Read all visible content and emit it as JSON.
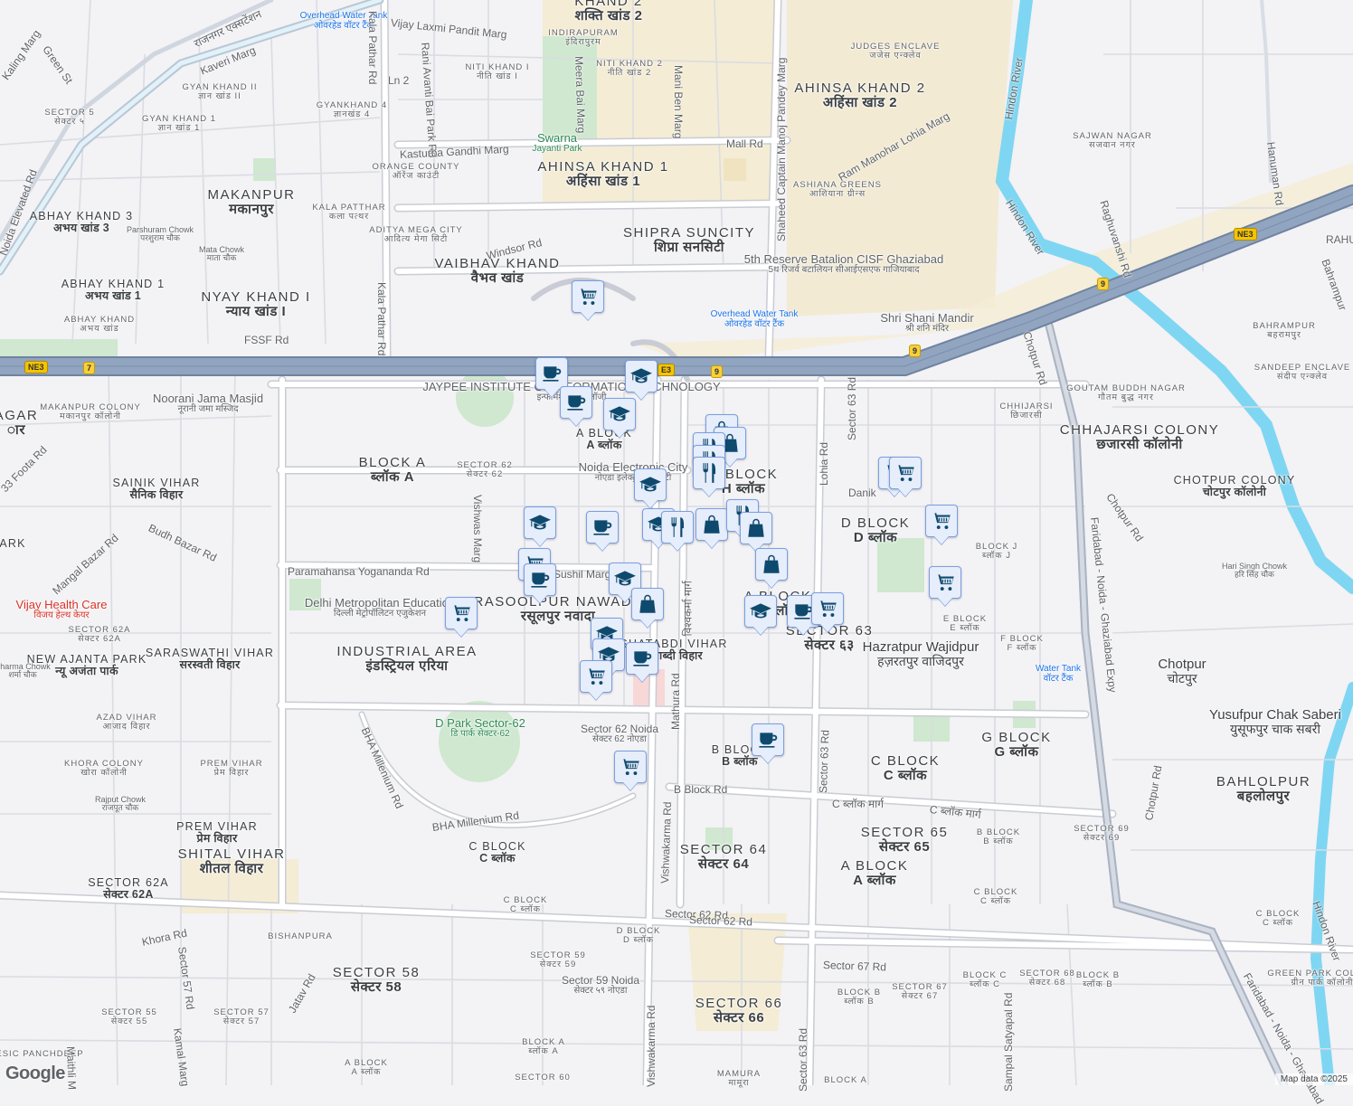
{
  "map": {
    "attribution": "Map data ©2025",
    "logo": "Google",
    "colors": {
      "highway": "#8ea2bd",
      "river": "#7fd6f2",
      "park": "#c8e6c9",
      "beige": "#f4ecd4",
      "marker_bg": "#e6edfb",
      "marker_icon": "#0e4a6e"
    }
  },
  "markers": [
    "shopping-cart",
    "coffee",
    "graduation-cap",
    "coffee",
    "graduation-cap",
    "shopping-bag",
    "shopping-bag",
    "restaurant",
    "restaurant",
    "restaurant",
    "graduation-cap",
    "shopping-cart",
    "shopping-cart",
    "graduation-cap",
    "coffee",
    "graduation-cap",
    "restaurant",
    "shopping-bag",
    "restaurant",
    "shopping-bag",
    "shopping-cart",
    "shopping-cart",
    "coffee",
    "shopping-bag",
    "graduation-cap",
    "shopping-bag",
    "shopping-cart",
    "graduation-cap",
    "coffee",
    "shopping-cart",
    "shopping-cart",
    "graduation-cap",
    "graduation-cap",
    "coffee",
    "shopping-cart",
    "coffee",
    "shopping-cart"
  ],
  "shields": [
    "NE3",
    "7",
    "E3",
    "9",
    "9",
    "9",
    "NE3"
  ],
  "labels": [
    {
      "en": "KHAND 2",
      "hi": "शक्ति खांड 2"
    },
    {
      "en": "INDIRAPURAM",
      "hi": "इंदिरापुरम"
    },
    {
      "en": "NITI KHAND I",
      "hi": "नीति खांड I"
    },
    {
      "en": "NITI KHAND 2",
      "hi": "नीति खांड 2"
    },
    {
      "en": "JUDGES ENCLAVE",
      "hi": "जजेस एन्क्लेव"
    },
    {
      "en": "AHINSA KHAND 2",
      "hi": "अहिंसा खांड 2"
    },
    {
      "en": "SAJWAN NAGAR",
      "hi": "सजवान नगर"
    },
    {
      "en": "GYAN KHAND II",
      "hi": "ज्ञान खांड II"
    },
    {
      "en": "GYANKHAND 4",
      "hi": "ज्ञानखंड 4"
    },
    {
      "en": "SECTOR 5",
      "hi": "सेक्टर ५"
    },
    {
      "en": "GYAN KHAND 1",
      "hi": "ज्ञान खांड 1"
    },
    {
      "en": "Swarna",
      "hi": "Jayanti Park"
    },
    {
      "en": "AHINSA KHAND 1",
      "hi": "अहिंसा खांड 1"
    },
    {
      "en": "ORANGE COUNTY",
      "hi": "ऑरेंज काउंटी"
    },
    {
      "en": "ASHIANA GREENS",
      "hi": "आशियाना ग्रीन्स"
    },
    {
      "en": "MAKANPUR",
      "hi": "मकानपुर"
    },
    {
      "en": "KALA PATTHAR",
      "hi": "कला पत्थर"
    },
    {
      "en": "ABHAY KHAND 3",
      "hi": "अभय खांड 3"
    },
    {
      "en": "SHIPRA SUNCITY",
      "hi": "शिप्रा सनसिटी"
    },
    {
      "en": "Parshuram Chowk",
      "hi": "परशुराम चौक"
    },
    {
      "en": "ADITYA MEGA CITY",
      "hi": "आदित्य मेगा सिटी"
    },
    {
      "en": "Mata Chowk",
      "hi": "माता चौक"
    },
    {
      "en": "VAIBHAV KHAND",
      "hi": "वैभव खांड"
    },
    {
      "en": "ABHAY KHAND 1",
      "hi": "अभय खांड 1"
    },
    {
      "en": "NYAY KHAND I",
      "hi": "न्याय खांड I"
    },
    {
      "en": "ABHAY KHAND",
      "hi": "अभय खांड"
    },
    {
      "en": "5th Reserve Batalion CISF Ghaziabad",
      "hi": "5थ रिजर्व बटालियन सीआईएसएफ गाजियाबाद"
    },
    {
      "en": "Shri Shani Mandir",
      "hi": "श्री शनि मंदिर"
    },
    {
      "en": "Overhead Water Tank",
      "hi": "ओवरहेड वॉटर टैंक"
    },
    {
      "en": "Overhead Water Tank",
      "hi": "ओवरहेड वॉटर टैंक"
    },
    {
      "en": "BAHRAMPUR",
      "hi": "बहरामपुर"
    },
    {
      "en": "SANDEEP ENCLAVE",
      "hi": "संदीप एन्क्लेव"
    },
    {
      "en": "GOUTAM BUDDH NAGAR",
      "hi": "गौतम बुद्ध नगर"
    },
    {
      "en": "CHHIJARSI",
      "hi": "छिजारसी"
    },
    {
      "en": "CHHAJARSI COLONY",
      "hi": "छजारसी कॉलोनी"
    },
    {
      "en": "CHOTPUR COLONY",
      "hi": "चोटपुर कॉलोनी"
    },
    {
      "en": "Noorani Jama Masjid",
      "hi": "नूरानी जमा मस्जिद"
    },
    {
      "en": "MAKANPUR COLONY",
      "hi": "मकानपुर कॉलोनी"
    },
    {
      "en": "AGAR",
      "hi": "ार"
    },
    {
      "en": "BLOCK A",
      "hi": "ब्लॉक A"
    },
    {
      "en": "SECTOR 62",
      "hi": "सेक्टर 62"
    },
    {
      "en": "A BLOCK",
      "hi": "A ब्लॉक"
    },
    {
      "en": "Noida Electronic City",
      "hi": "नोएडा इलेक्ट्रॉनिक सिटी"
    },
    {
      "en": "H BLOCK",
      "hi": "H ब्लॉक"
    },
    {
      "en": "SAINIK VIHAR",
      "hi": "सैनिक विहार"
    },
    {
      "en": "D BLOCK",
      "hi": "D ब्लॉक"
    },
    {
      "en": "BLOCK J",
      "hi": "ब्लॉक J"
    },
    {
      "en": "Hari Singh Chowk",
      "hi": "हरि सिंह चौक"
    },
    {
      "en": "ARK",
      "hi": ""
    },
    {
      "en": "RASOOLPUR NAWADA",
      "hi": "रसूलपुर नवादा"
    },
    {
      "en": "Delhi Metropolitan Education",
      "hi": "दिल्ली मेट्रोपॉलिटन एजुकेशन"
    },
    {
      "en": "Vijay Health Care",
      "hi": "विजय हेल्थ केयर"
    },
    {
      "en": "SECTOR 62A",
      "hi": "सेक्टर 62A"
    },
    {
      "en": "A BLOCK",
      "hi": "A ब्लॉक"
    },
    {
      "en": "SECTOR 63",
      "hi": "सेक्टर ६३"
    },
    {
      "en": "E BLOCK",
      "hi": "E ब्लॉक"
    },
    {
      "en": "F BLOCK",
      "hi": "F ब्लॉक"
    },
    {
      "en": "INDUSTRIAL AREA",
      "hi": "इंडस्ट्रियल एरिया"
    },
    {
      "en": "SARASWATHI VIHAR",
      "hi": "सरस्वती विहार"
    },
    {
      "en": "NEW AJANTA PARK",
      "hi": "न्यू अजंता पार्क"
    },
    {
      "en": "Sharma Chowk",
      "hi": "शर्मा चौक"
    },
    {
      "en": "SHATABDI VIHAR",
      "hi": "शताब्दी विहार"
    },
    {
      "en": "Hazratpur Wajidpur",
      "hi": "हज़रतपुर वाजिदपुर"
    },
    {
      "en": "Water Tank",
      "hi": "वॉटर टैंक"
    },
    {
      "en": "Chotpur",
      "hi": "चोटपुर"
    },
    {
      "en": "Yusufpur Chak Saberi",
      "hi": "युसूफपुर चाक सबरी"
    },
    {
      "en": "AZAD VIHAR",
      "hi": "आजाद विहार"
    },
    {
      "en": "D Park Sector-62",
      "hi": "डि पार्क सेक्टर-62"
    },
    {
      "en": "Sector 62 Noida",
      "hi": "सेक्टर 62 नोएडा"
    },
    {
      "en": "B BLOCK",
      "hi": "B ब्लॉक"
    },
    {
      "en": "G BLOCK",
      "hi": "G ब्लॉक"
    },
    {
      "en": "C BLOCK",
      "hi": "C ब्लॉक"
    },
    {
      "en": "KHORA COLONY",
      "hi": "खोरा कॉलोनी"
    },
    {
      "en": "PREM VIHAR",
      "hi": "प्रेम विहार"
    },
    {
      "en": "Rajput Chowk",
      "hi": "राजपूत चौक"
    },
    {
      "en": "BAHLOLPUR",
      "hi": "बहलोलपुर"
    },
    {
      "en": "PREM VIHAR",
      "hi": "प्रेम विहार"
    },
    {
      "en": "SHITAL VIHAR",
      "hi": "शीतल विहार"
    },
    {
      "en": "SECTOR 65",
      "hi": "सेक्टर 65"
    },
    {
      "en": "SECTOR 69",
      "hi": "सेक्टर 69"
    },
    {
      "en": "B BLOCK",
      "hi": "B ब्लॉक"
    },
    {
      "en": "C BLOCK",
      "hi": "C ब्लॉक"
    },
    {
      "en": "SECTOR 64",
      "hi": "सेक्टर 64"
    },
    {
      "en": "A BLOCK",
      "hi": "A ब्लॉक"
    },
    {
      "en": "SECTOR 62A",
      "hi": "सेक्टर 62A"
    },
    {
      "en": "C BLOCK",
      "hi": "C ब्लॉक"
    },
    {
      "en": "C BLOCK",
      "hi": "C ब्लॉक"
    },
    {
      "en": "C BLOCK",
      "hi": "C ब्लॉक"
    },
    {
      "en": "BISHANPURA",
      "hi": ""
    },
    {
      "en": "D BLOCK",
      "hi": "D ब्लॉक"
    },
    {
      "en": "SECTOR 59",
      "hi": "सेक्टर 59"
    },
    {
      "en": "SECTOR 58",
      "hi": "सेक्टर 58"
    },
    {
      "en": "Sector 59 Noida",
      "hi": "सेक्टर ५९ नोएडा"
    },
    {
      "en": "BLOCK C",
      "hi": "ब्लॉक C"
    },
    {
      "en": "SECTOR 68",
      "hi": "सेक्टर 68"
    },
    {
      "en": "BLOCK B",
      "hi": "ब्लॉक B"
    },
    {
      "en": "GREEN PARK COLONY",
      "hi": "ग्रीन पार्क कॉलोनी"
    },
    {
      "en": "BLOCK B",
      "hi": "ब्लॉक B"
    },
    {
      "en": "SECTOR 67",
      "hi": "सेक्टर 67"
    },
    {
      "en": "SECTOR 66",
      "hi": "सेक्टर 66"
    },
    {
      "en": "SECTOR 55",
      "hi": "सेक्टर 55"
    },
    {
      "en": "SECTOR 57",
      "hi": "सेक्टर 57"
    },
    {
      "en": "BLOCK A",
      "hi": "ब्लॉक A"
    },
    {
      "en": "A BLOCK",
      "hi": "A ब्लॉक"
    },
    {
      "en": "ESIC PANCHDEEP",
      "hi": ""
    },
    {
      "en": "MAMURA",
      "hi": "मामूरा"
    },
    {
      "en": "SECTOR 60",
      "hi": ""
    },
    {
      "en": "BLOCK A",
      "hi": ""
    },
    {
      "en": "JAYPEE INSTITUTE OF INFORMATION TECHNOLOGY",
      "hi": "इन्फॉर्मेशन टेक्नोलॉजी"
    }
  ],
  "roads": [
    "Vijay Laxmi Pandit Marg",
    "Kala Pathar Rd",
    "Rani Avanti Bai Park Rd",
    "Meera Bai Marg",
    "Mani Ben Marg",
    "Shaheed Captain Manoj Pandey Marg",
    "Mall Rd",
    "Kasturba Gandhi Marg",
    "Ram Manohar Lohia Marg",
    "Kaveri Marg",
    "Windsor Rd",
    "Ln 2",
    "FSSF Rd",
    "Kala Pathar Rd",
    "Hindon River",
    "Hindon River",
    "Raghuvanshi Rd",
    "Hanuman Rd",
    "Chotpur Rd",
    "Sector 63 Rd",
    "Lohia Rd",
    "Faridabad - Noida - Ghaziabad Expy",
    "Chotpur Rd",
    "Vishwas Marg",
    "Paramahansa Yogananda Rd",
    "Sushil Marg",
    "Budh Bazar Rd",
    "Mangal Bazar Rd",
    "33 Foota Rd",
    "BHA Millenium Rd",
    "BHA Millenium Rd",
    "Mathura Rd",
    "Vishwakarma Rd",
    "B Block Rd",
    "Sector 63 Rd",
    "C ब्लॉक मार्ग",
    "C ब्लॉक मार्ग",
    "Chotpur Rd",
    "Sector 62 Rd",
    "Sector 67 Rd",
    "Khora Rd",
    "Sector 57 Rd",
    "Jatav Rd",
    "Kamal Marg",
    "Vishwakarma Rd",
    "Sampal Satyapal Rd",
    "Faridabad - Noida - Ghaziabad",
    "Hindon River",
    "Bahrampur",
    "Green St",
    "Kaling Marg",
    "Noida Elevated Rd",
    "राजनगर एक्सटेंशन",
    "Sector 63 Rd",
    "Maithli M",
    "Danik",
    "RAHU",
    "विश्वकर्मा मार्ग",
    "Sector 62 Rd"
  ]
}
